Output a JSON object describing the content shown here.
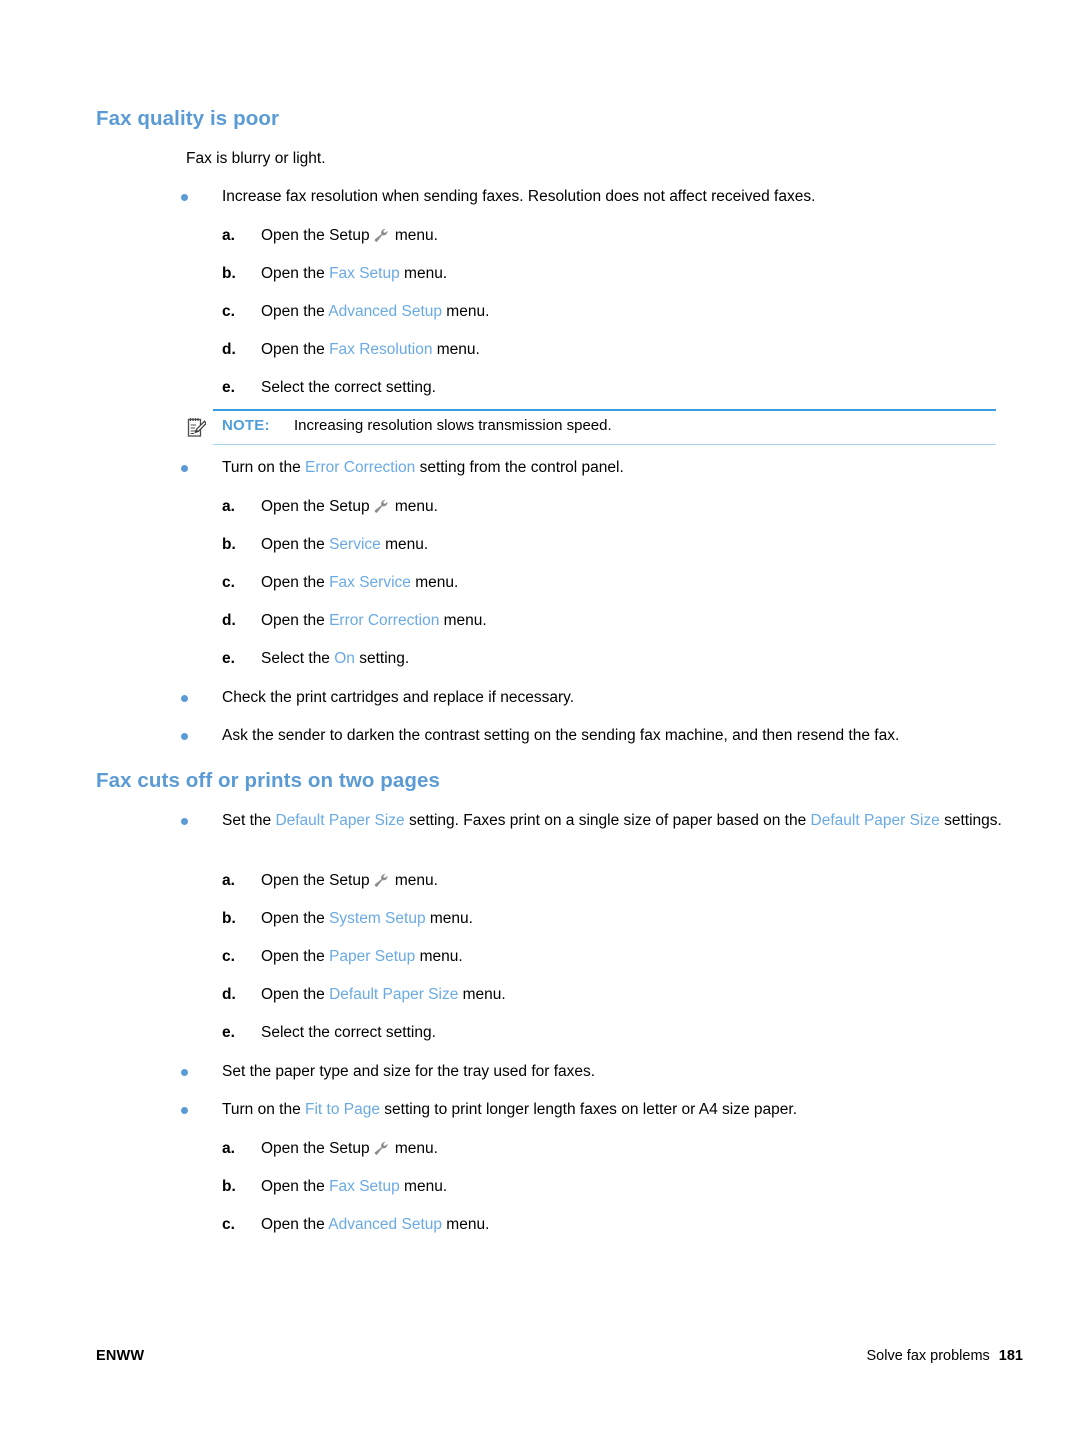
{
  "page": {
    "background_color": "#ffffff",
    "accent_color": "#5b9bd5",
    "ui_token_color": "#6aaae4",
    "text_color": "#000000"
  },
  "sections": [
    {
      "heading": "Fax quality is poor",
      "intro": "Fax is blurry or light."
    },
    {
      "heading": "Fax cuts off or prints on two pages"
    }
  ],
  "bullets": {
    "b1_part1": "Increase fax resolution when sending faxes. Resolution does not affect received faxes.",
    "b2_part1": "Turn on the ",
    "b2_ui": "Error Correction",
    "b2_part2": " setting from the control panel.",
    "b3": "Check the print cartridges and replace if necessary.",
    "b4": "Ask the sender to darken the contrast setting on the sending fax machine, and then resend the fax.",
    "b5_part1": "Set the ",
    "b5_ui1": "Default Paper Size",
    "b5_part2": " setting. Faxes print on a single size of paper based on the ",
    "b5_ui2": "Default Paper Size",
    "b5_part3": " settings.",
    "b6": "Set the paper type and size for the tray used for faxes.",
    "b7_part1": "Turn on the ",
    "b7_ui": "Fit to Page",
    "b7_part2": " setting to print longer length faxes on letter or A4 size paper."
  },
  "steps": {
    "markers": {
      "a": "a.",
      "b": "b.",
      "c": "c.",
      "d": "d.",
      "e": "e."
    },
    "open_the": "Open the ",
    "setup_word": "Setup",
    "menu_word": " menu.",
    "select_correct": "Select the correct setting.",
    "select_the": "Select the ",
    "setting_word": " setting.",
    "group1": {
      "b_ui": "Fax Setup",
      "c_ui": "Advanced Setup",
      "d_ui": "Fax Resolution",
      "e_text": "Select the correct setting."
    },
    "group2": {
      "b_ui": "Service",
      "c_ui": "Fax Service",
      "d_ui": "Error Correction",
      "e_ui": "On"
    },
    "group3": {
      "b_ui": "System Setup",
      "c_ui": "Paper Setup",
      "d_ui": "Default Paper Size",
      "e_text": "Select the correct setting."
    },
    "group4": {
      "b_ui": "Fax Setup",
      "c_ui": "Advanced Setup"
    }
  },
  "note": {
    "label": "NOTE:",
    "text": "Increasing resolution slows transmission speed.",
    "icon": "note-pencil-icon",
    "rule_color_top": "#3c9ade",
    "rule_color_bottom": "#a9d3ef"
  },
  "footer": {
    "left": "ENWW",
    "right_label": "Solve fax problems",
    "page_number": "181"
  },
  "icons": {
    "wrench": "wrench-icon"
  }
}
